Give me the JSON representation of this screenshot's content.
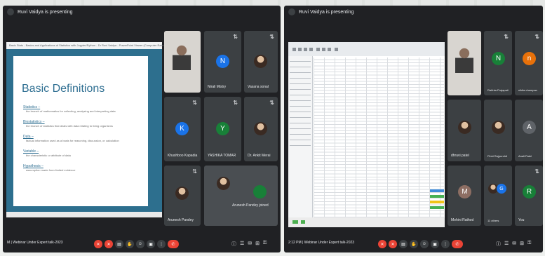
{
  "left": {
    "presenting": "Ruvi Vaidya is presenting",
    "share": {
      "tab_title": "Basic Stats - Basics and Applications of Statistics with Jupyter/Python - Dr Ruvi Vaidya - PowerPoint Viewer (Computer Rated)",
      "slide": {
        "title": "Basic Definitions",
        "definitions": [
          {
            "term": "Statistics –",
            "desc": "the branch of mathematics for collecting, analyzing and interpreting data"
          },
          {
            "term": "Biostatistics –",
            "desc": "the branch of statistics that deals with data relating to living organisms"
          },
          {
            "term": "Data –",
            "desc": "factual information used as a basis for reasoning, discussion, or calculation"
          },
          {
            "term": "Variable –",
            "desc": "the characteristic or attribute of data"
          },
          {
            "term": "Hypothesis –",
            "desc": "assumption made from limited evidence"
          }
        ]
      }
    },
    "participants": [
      {
        "name": "Nirali Mistry",
        "initial": "N",
        "color": "#1a73e8"
      },
      {
        "name": "Vasana sonal",
        "initial": "",
        "color": ""
      },
      {
        "name": "Khushboo Kapadia",
        "initial": "K",
        "color": "#1a73e8"
      },
      {
        "name": "YASHIKA TOMAR",
        "initial": "Y",
        "color": "#188038"
      },
      {
        "name": "Dr. Ankit Merai",
        "initial": "",
        "color": ""
      },
      {
        "name": "Arunesh Pandey",
        "initial": "",
        "color": ""
      },
      {
        "name": "Arunesh Pandey joined",
        "initial": "",
        "color": ""
      }
    ],
    "meeting": "M  |  Webinar Under Expert talk-2023"
  },
  "right": {
    "presenting": "Ruvi Vaidya is presenting",
    "participants": [
      {
        "name": "Rahhta Prajapati",
        "initial": "N",
        "color": "#188038"
      },
      {
        "name": "nikita champan",
        "initial": "n",
        "color": "#e8710a"
      },
      {
        "name": "dhruvi patel",
        "initial": "",
        "color": ""
      },
      {
        "name": "Pinki Rajpurohit",
        "initial": "",
        "color": ""
      },
      {
        "name": "Anali Patel",
        "initial": "A",
        "color": "#5f6368"
      },
      {
        "name": "Mohini Rathod",
        "initial": "M",
        "color": "#8d6e63"
      },
      {
        "name": "11 others",
        "initial": "",
        "color": ""
      },
      {
        "name": "You",
        "initial": "R",
        "color": "#188038"
      }
    ],
    "meeting": "2:12 PM  |  Webinar Under Expert talk-2023"
  }
}
